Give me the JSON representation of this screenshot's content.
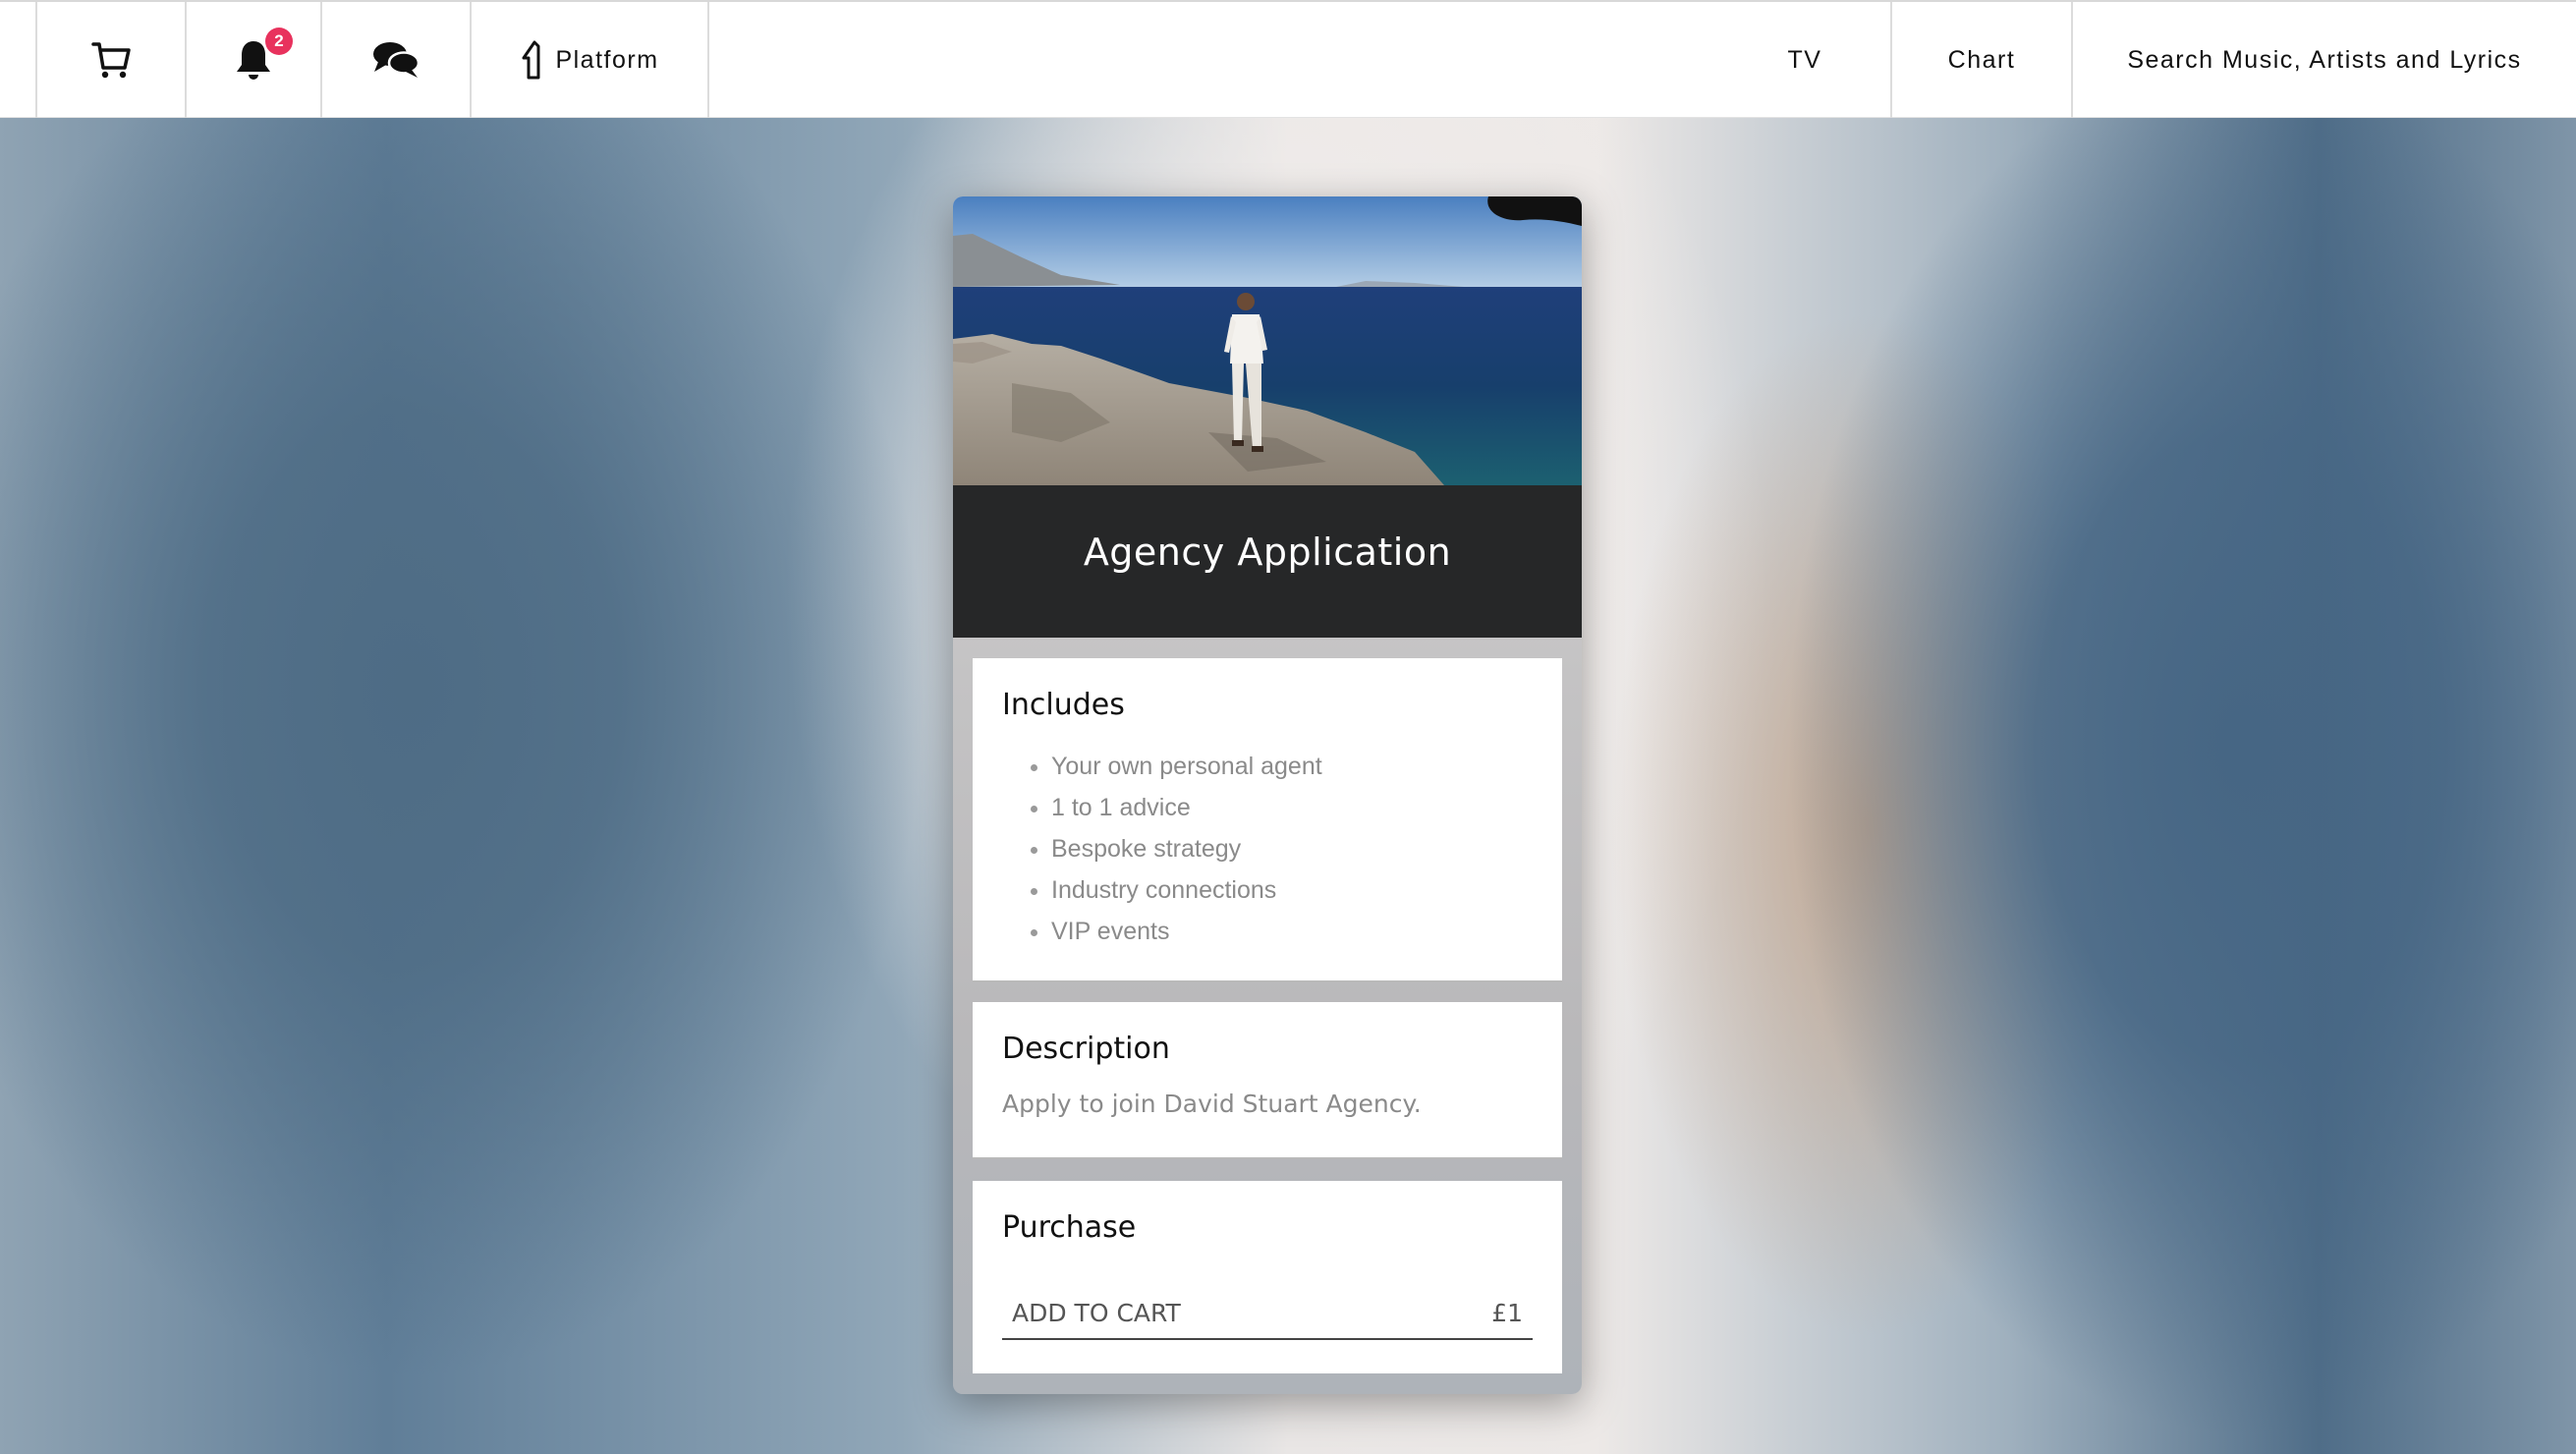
{
  "navbar": {
    "notification_count": "2",
    "platform_label": "Platform",
    "tv_label": "TV",
    "chart_label": "Chart",
    "search_label": "Search Music, Artists and Lyrics"
  },
  "product": {
    "title": "Agency Application",
    "includes": {
      "heading": "Includes",
      "items": [
        "Your own personal agent",
        "1 to 1 advice",
        "Bespoke strategy",
        "Industry connections",
        "VIP events"
      ]
    },
    "description": {
      "heading": "Description",
      "text": "Apply to join David Stuart Agency."
    },
    "purchase": {
      "heading": "Purchase",
      "button_label": "ADD TO CART",
      "price": "£1"
    }
  },
  "colors": {
    "badge": "#e8325d",
    "title_bar": "#262728"
  },
  "icons": [
    "cart-icon",
    "bell-icon",
    "chat-icon",
    "platform-logo-icon"
  ]
}
